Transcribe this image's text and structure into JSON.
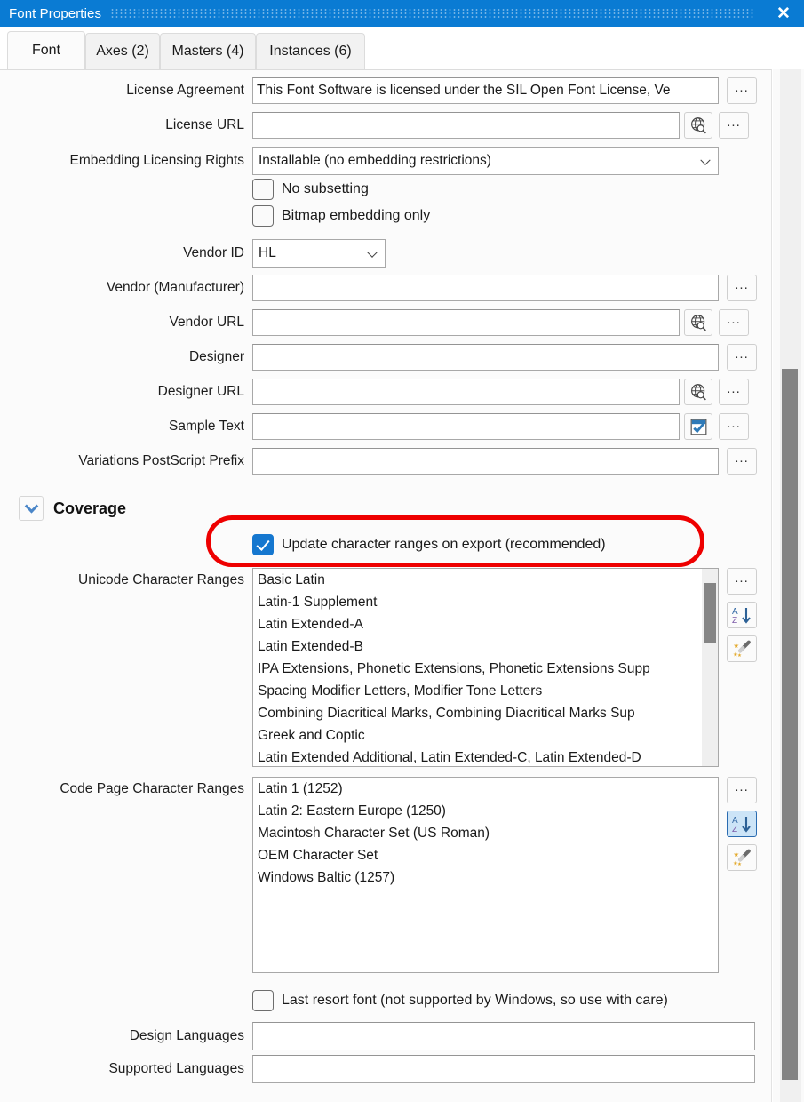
{
  "window": {
    "title": "Font Properties",
    "close_label": "✕"
  },
  "tabs": [
    {
      "label": "Font",
      "active": true
    },
    {
      "label": "Axes (2)",
      "active": false
    },
    {
      "label": "Masters (4)",
      "active": false
    },
    {
      "label": "Instances (6)",
      "active": false
    }
  ],
  "fields": {
    "license_agreement": {
      "label": "License Agreement",
      "value": "This Font Software is licensed under the SIL Open Font License, Ve",
      "button": "..."
    },
    "license_url": {
      "label": "License URL",
      "value": "",
      "placeholder": "",
      "globe_button": "globe-search-icon",
      "button": "..."
    },
    "embedding_rights": {
      "label": "Embedding Licensing Rights",
      "value": "Installable (no embedding restrictions)",
      "options": [
        "Installable (no embedding restrictions)"
      ]
    },
    "no_subsetting": {
      "label": "No subsetting",
      "checked": false
    },
    "bitmap_embedding_only": {
      "label": "Bitmap embedding only",
      "checked": false
    },
    "vendor_id": {
      "label": "Vendor ID",
      "value": "HL",
      "options": [
        "HL"
      ]
    },
    "vendor_manufacturer": {
      "label": "Vendor (Manufacturer)",
      "value": "",
      "button": "..."
    },
    "vendor_url": {
      "label": "Vendor URL",
      "value": "",
      "globe_button": "globe-search-icon",
      "button": "..."
    },
    "designer": {
      "label": "Designer",
      "value": "",
      "button": "..."
    },
    "designer_url": {
      "label": "Designer URL",
      "value": "",
      "globe_button": "globe-search-icon",
      "button": "..."
    },
    "sample_text": {
      "label": "Sample Text",
      "value": "",
      "check_button": "checkbox-check-icon",
      "button": "..."
    },
    "variations_ps_prefix": {
      "label": "Variations PostScript Prefix",
      "value": "",
      "button": "..."
    }
  },
  "coverage": {
    "section_title": "Coverage",
    "expanded": true,
    "update_ranges": {
      "label": "Update character ranges on export (recommended)",
      "checked": true,
      "highlighted": true
    },
    "unicode_ranges": {
      "label": "Unicode Character Ranges",
      "items": [
        "Basic Latin",
        "Latin-1 Supplement",
        "Latin Extended-A",
        "Latin Extended-B",
        "IPA Extensions, Phonetic Extensions, Phonetic Extensions Supp",
        "Spacing Modifier Letters, Modifier Tone Letters",
        "Combining Diacritical Marks, Combining Diacritical Marks Sup",
        "Greek and Coptic",
        "Latin Extended Additional, Latin Extended-C, Latin Extended-D"
      ],
      "buttons": [
        {
          "name": "ellipsis-button",
          "label": "...",
          "selected": false
        },
        {
          "name": "sort-az-button",
          "label": "A↓Z",
          "selected": false
        },
        {
          "name": "magic-wand-button",
          "label": "wand",
          "selected": false
        }
      ]
    },
    "codepage_ranges": {
      "label": "Code Page Character Ranges",
      "items": [
        "Latin 1 (1252)",
        "Latin 2: Eastern Europe (1250)",
        "Macintosh Character Set (US Roman)",
        "OEM Character Set",
        "Windows Baltic (1257)"
      ],
      "buttons": [
        {
          "name": "ellipsis-button",
          "label": "...",
          "selected": false
        },
        {
          "name": "sort-az-button",
          "label": "A↓Z",
          "selected": true
        },
        {
          "name": "magic-wand-button",
          "label": "wand",
          "selected": false
        }
      ]
    },
    "last_resort_font": {
      "label": "Last resort font (not supported by Windows, so use with care)",
      "checked": false
    },
    "design_languages": {
      "label": "Design Languages",
      "value": ""
    },
    "supported_languages": {
      "label": "Supported Languages",
      "value": ""
    }
  },
  "colors": {
    "titlebar": "#0a7bd3",
    "accent_check": "#1577cf",
    "annotation": "#ee0000",
    "selected_button": "#cce4f7"
  }
}
